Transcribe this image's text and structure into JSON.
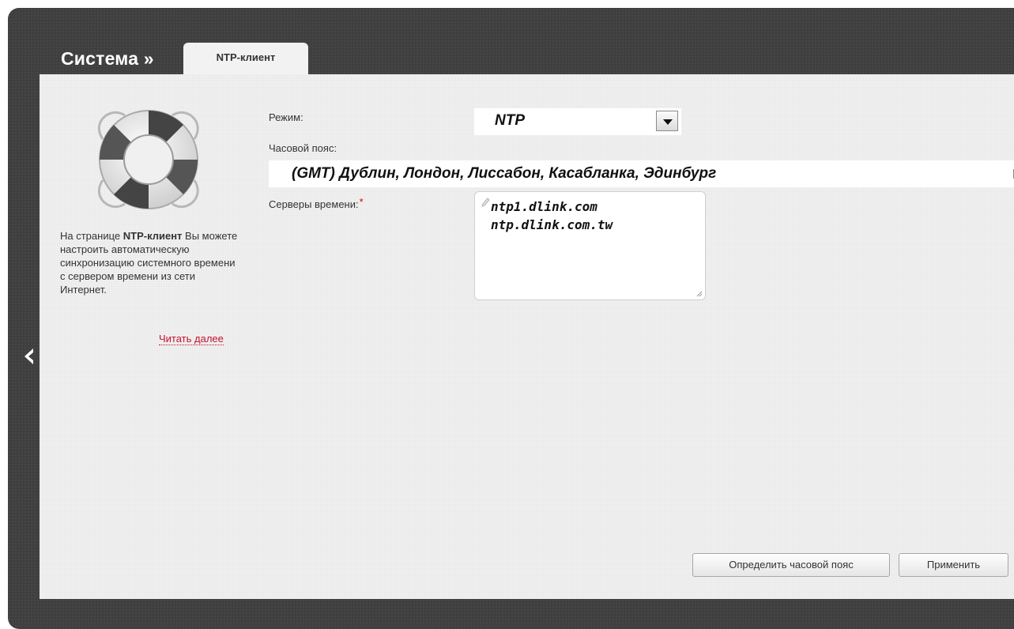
{
  "header": {
    "breadcrumb_root": "Система »",
    "active_tab": "NTP-клиент"
  },
  "sidebar": {
    "description_prefix": "На странице ",
    "description_bold": "NTP-клиент",
    "description_suffix": " Вы можете настроить автоматическую синхронизацию системного времени с сервером времени из сети Интернет.",
    "read_more": "Читать далее"
  },
  "form": {
    "mode_label": "Режим:",
    "mode_value": "NTP",
    "timezone_label": "Часовой пояс:",
    "timezone_value": "(GMT) Дублин, Лондон, Лиссабон, Касабланка, Эдинбург",
    "servers_label": "Серверы времени:",
    "servers_required_mark": "*",
    "servers": [
      "ntp1.dlink.com",
      "ntp.dlink.com.tw"
    ]
  },
  "buttons": {
    "detect_timezone": "Определить часовой пояс",
    "apply": "Применить"
  },
  "colors": {
    "frame": "#3f3f3f",
    "panel": "#f0f0f0",
    "link": "#c8102e",
    "required": "#e00000"
  },
  "icons": {
    "back": "chevron-left-icon",
    "hero": "lifebuoy-icon",
    "edit": "pencil-icon"
  }
}
